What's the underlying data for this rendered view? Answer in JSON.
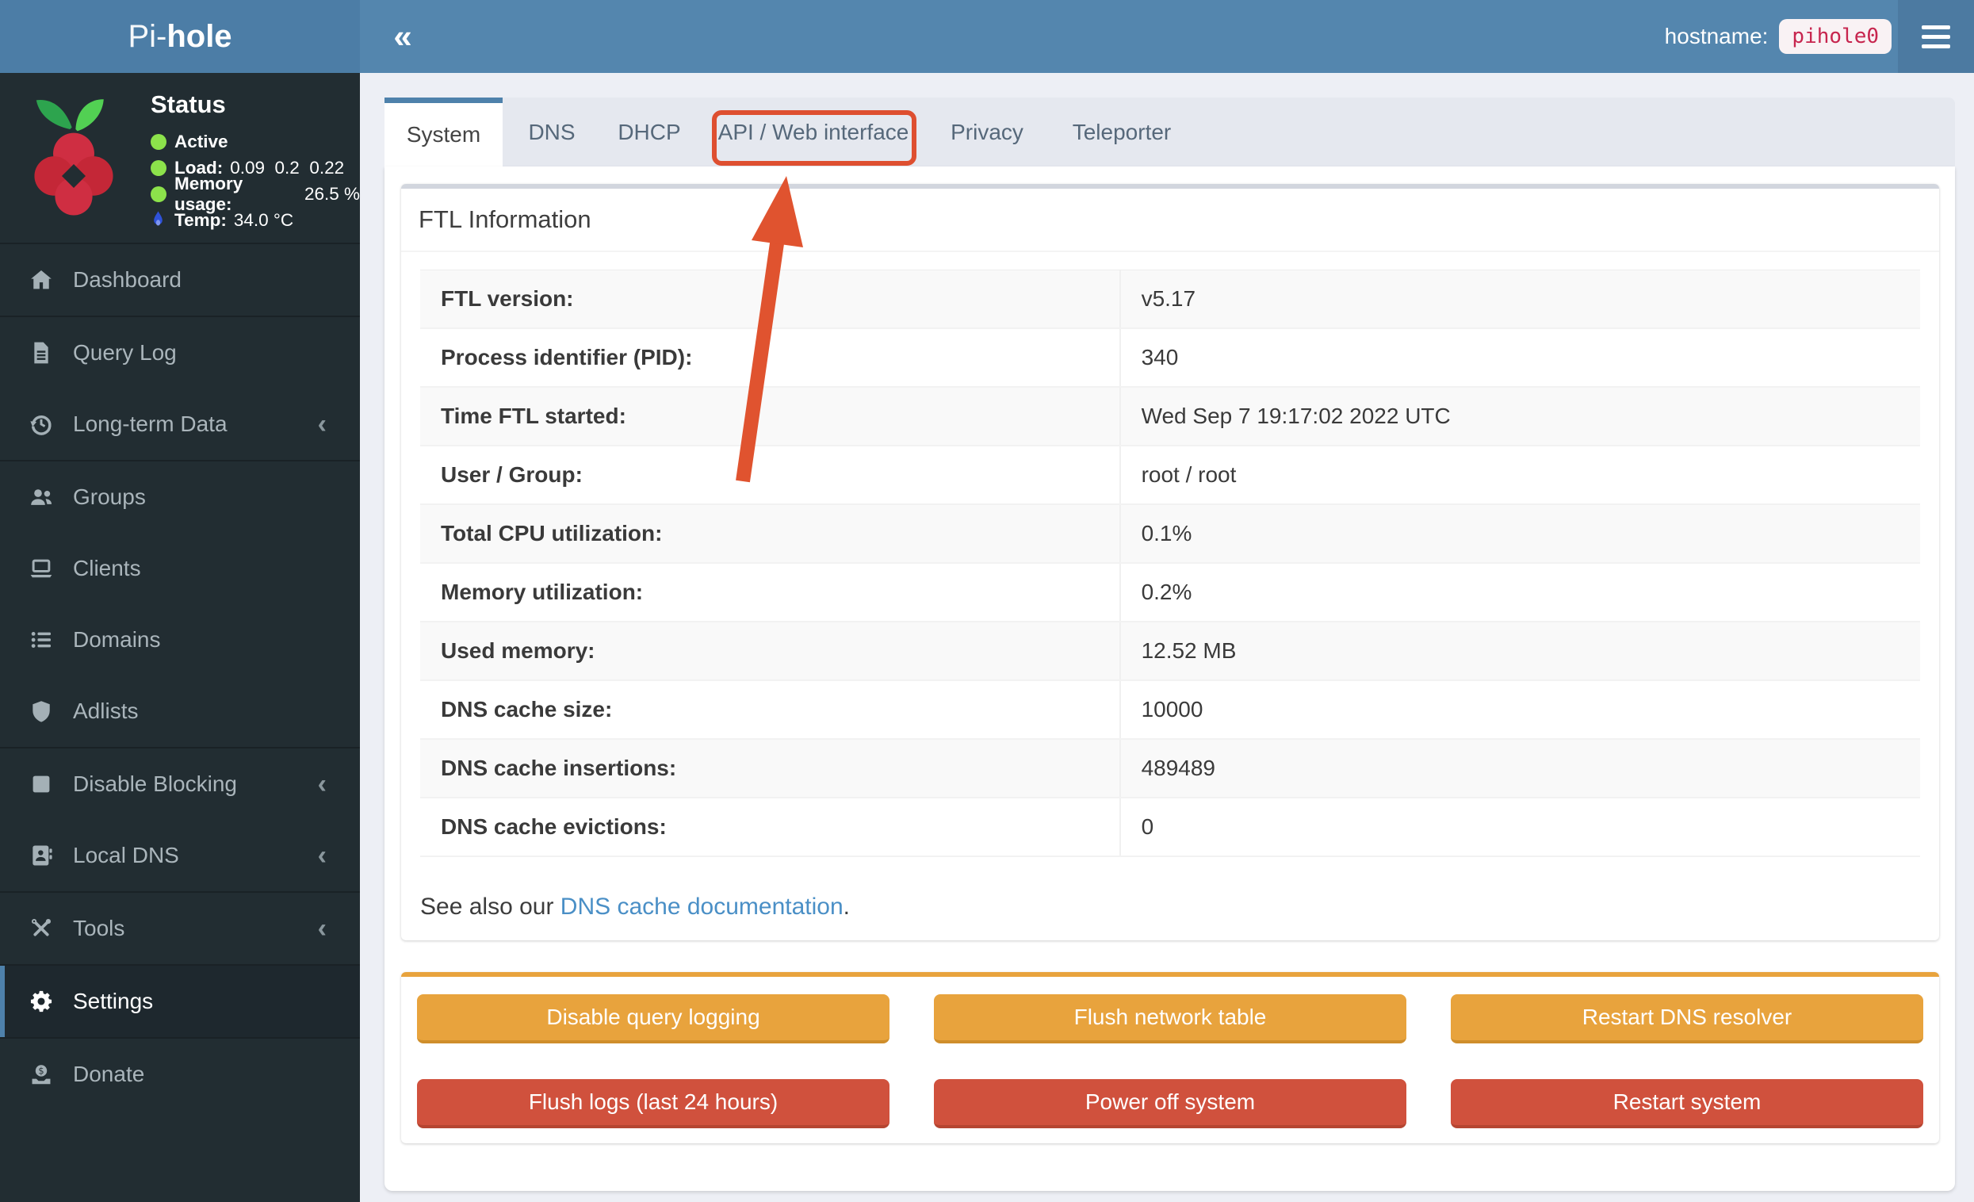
{
  "navbar": {
    "logo_prefix": "Pi-",
    "logo_bold": "hole",
    "collapse_glyph": "«",
    "hostname_label": "hostname:",
    "hostname_value": "pihole0"
  },
  "status": {
    "title": "Status",
    "lines": [
      {
        "icon": "status-dot-green",
        "label": "Active",
        "value": ""
      },
      {
        "icon": "status-dot-green",
        "label": "Load:",
        "value": "0.09  0.2  0.22"
      },
      {
        "icon": "status-dot-green",
        "label": "Memory usage:",
        "value": "26.5 %"
      },
      {
        "icon": "temperature-icon",
        "label": "Temp:",
        "value": "34.0 °C"
      }
    ]
  },
  "menu": {
    "chevron_glyph": "‹",
    "items": [
      {
        "label": "Dashboard",
        "icon": "home-icon"
      },
      {
        "label": "Query Log",
        "icon": "file-icon"
      },
      {
        "label": "Long-term Data",
        "icon": "history-icon",
        "expandable": true
      },
      {
        "label": "Groups",
        "icon": "users-icon"
      },
      {
        "label": "Clients",
        "icon": "laptop-icon"
      },
      {
        "label": "Domains",
        "icon": "list-icon"
      },
      {
        "label": "Adlists",
        "icon": "shield-icon"
      },
      {
        "label": "Disable Blocking",
        "icon": "stop-icon",
        "expandable": true
      },
      {
        "label": "Local DNS",
        "icon": "address-book-icon",
        "expandable": true
      },
      {
        "label": "Tools",
        "icon": "wrench-icon",
        "expandable": true
      },
      {
        "label": "Settings",
        "icon": "gear-icon",
        "active": true
      },
      {
        "label": "Donate",
        "icon": "donate-icon"
      }
    ]
  },
  "tabs": {
    "active": "System",
    "highlighted": "API / Web interface",
    "items": [
      {
        "label": "System"
      },
      {
        "label": "DNS"
      },
      {
        "label": "DHCP"
      },
      {
        "label": "API / Web interface"
      },
      {
        "label": "Privacy"
      },
      {
        "label": "Teleporter"
      }
    ]
  },
  "ftl_card": {
    "title": "FTL Information",
    "rows": [
      {
        "label": "FTL version:",
        "value": "v5.17"
      },
      {
        "label": "Process identifier (PID):",
        "value": "340"
      },
      {
        "label": "Time FTL started:",
        "value": "Wed Sep 7 19:17:02 2022 UTC"
      },
      {
        "label": "User / Group:",
        "value": "root / root"
      },
      {
        "label": "Total CPU utilization:",
        "value": "0.1%"
      },
      {
        "label": "Memory utilization:",
        "value": "0.2%"
      },
      {
        "label": "Used memory:",
        "value": "12.52 MB"
      },
      {
        "label": "DNS cache size:",
        "value": "10000"
      },
      {
        "label": "DNS cache insertions:",
        "value": "489489"
      },
      {
        "label": "DNS cache evictions:",
        "value": "0"
      }
    ],
    "see_also_prefix": "See also our ",
    "see_also_link": "DNS cache documentation",
    "see_also_suffix": "."
  },
  "actions": {
    "warning_buttons": [
      {
        "label": "Disable query logging"
      },
      {
        "label": "Flush network table"
      },
      {
        "label": "Restart DNS resolver"
      }
    ],
    "danger_buttons": [
      {
        "label": "Flush logs (last 24 hours)"
      },
      {
        "label": "Power off system"
      },
      {
        "label": "Restart system"
      }
    ]
  },
  "colors": {
    "navbar_blue": "#5486ae",
    "logo_blue": "#4c7da6",
    "sidebar_dark": "#222d32",
    "active_border_blue": "#4e81ab",
    "status_green": "#8ce24b",
    "badge_text_red": "#c7254e",
    "warning_orange": "#e8a33d",
    "danger_red": "#d0513d",
    "annotation_red": "#de4f30",
    "link_blue": "#4a8fc6"
  }
}
